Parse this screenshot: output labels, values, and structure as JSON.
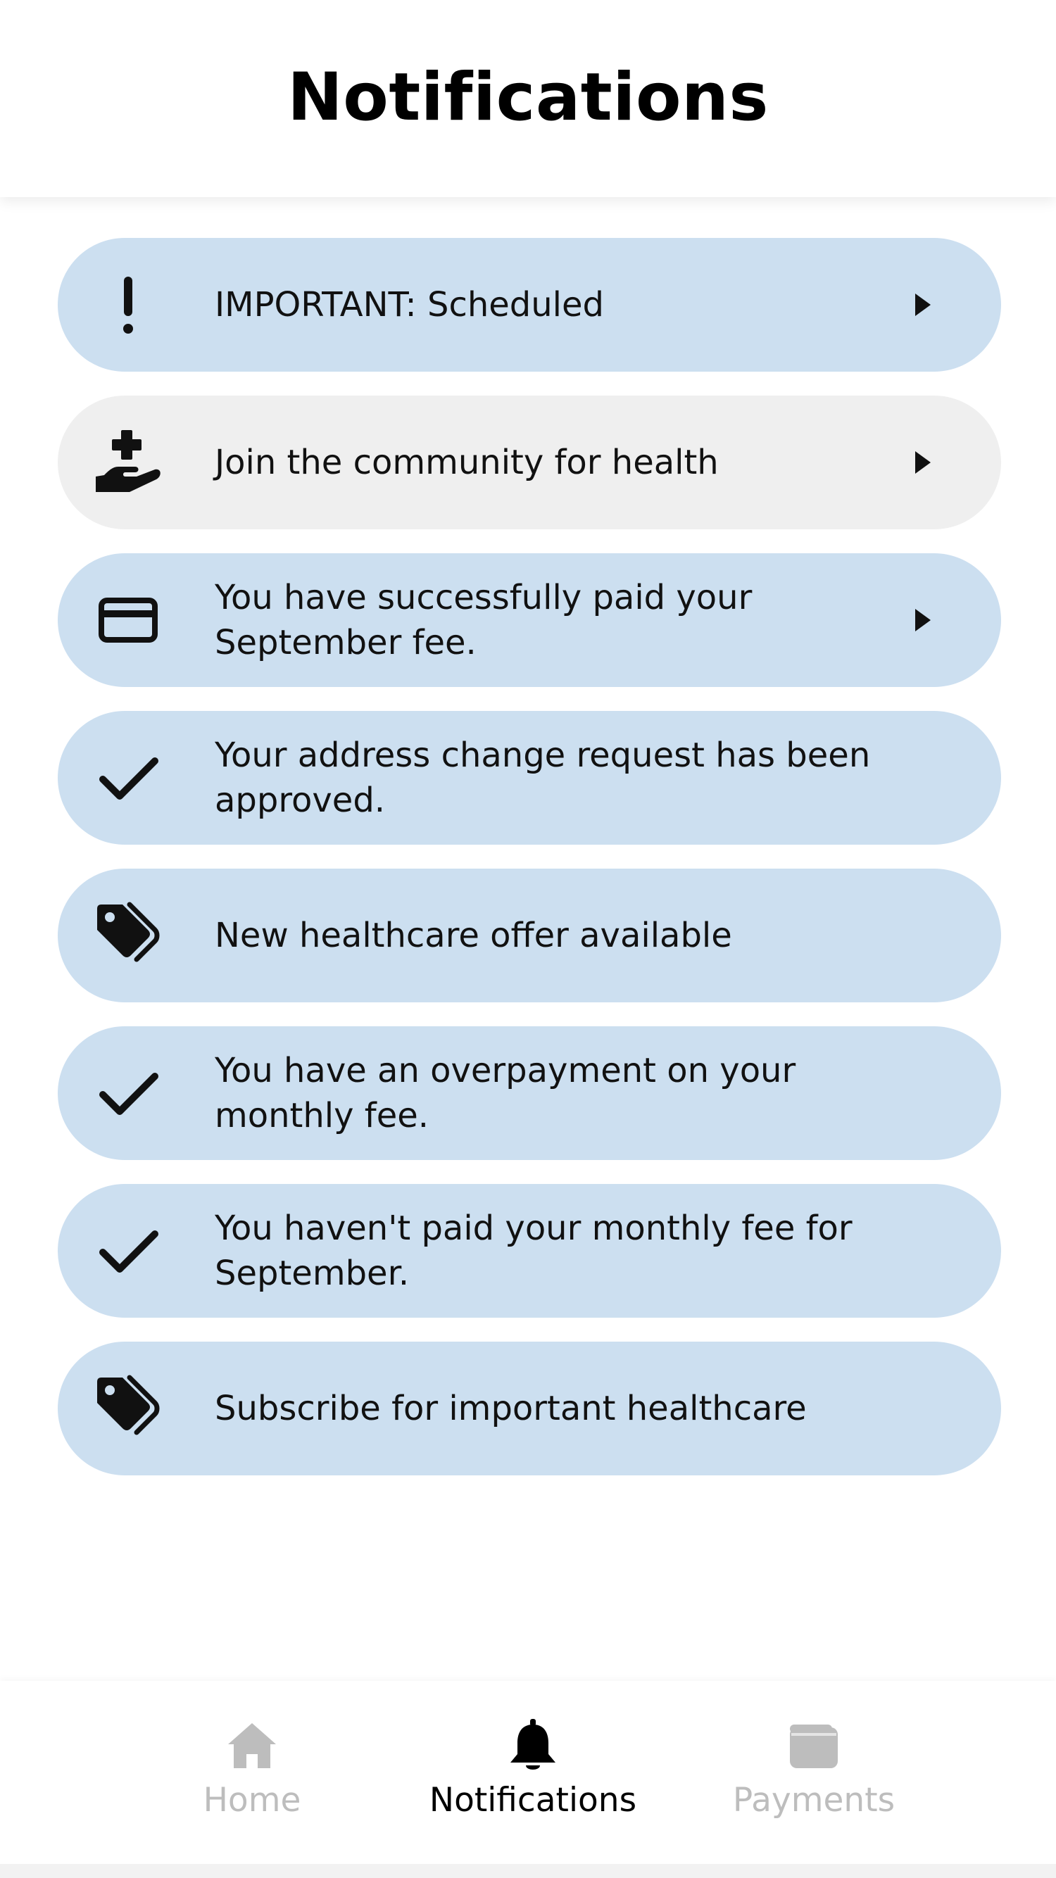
{
  "header": {
    "title": "Notifications"
  },
  "colors": {
    "card_blue": "#ccdff0",
    "card_gray": "#efefef",
    "active_tab": "#000000",
    "inactive_tab": "#bdbdbd"
  },
  "notifications": [
    {
      "icon": "exclamation-icon",
      "text": "IMPORTANT: Scheduled",
      "has_chevron": true,
      "style": "blue"
    },
    {
      "icon": "hand-holding-medical-icon",
      "text": "Join the community for health",
      "has_chevron": true,
      "style": "gray"
    },
    {
      "icon": "credit-card-icon",
      "text": "You have successfully paid your September fee.",
      "has_chevron": true,
      "style": "blue"
    },
    {
      "icon": "check-icon",
      "text": "Your address change request has been approved.",
      "has_chevron": false,
      "style": "blue"
    },
    {
      "icon": "tags-icon",
      "text": "New healthcare offer available",
      "has_chevron": false,
      "style": "blue"
    },
    {
      "icon": "check-icon",
      "text": "You have an overpayment on your monthly fee.",
      "has_chevron": false,
      "style": "blue"
    },
    {
      "icon": "check-icon",
      "text": "You haven't paid your monthly fee for September.",
      "has_chevron": false,
      "style": "blue"
    },
    {
      "icon": "tags-icon",
      "text": "Subscribe for important healthcare",
      "has_chevron": false,
      "style": "blue"
    }
  ],
  "tabs": [
    {
      "label": "Home",
      "icon": "home-icon",
      "active": false
    },
    {
      "label": "Notifications",
      "icon": "bell-icon",
      "active": true
    },
    {
      "label": "Payments",
      "icon": "wallet-icon",
      "active": false
    }
  ]
}
